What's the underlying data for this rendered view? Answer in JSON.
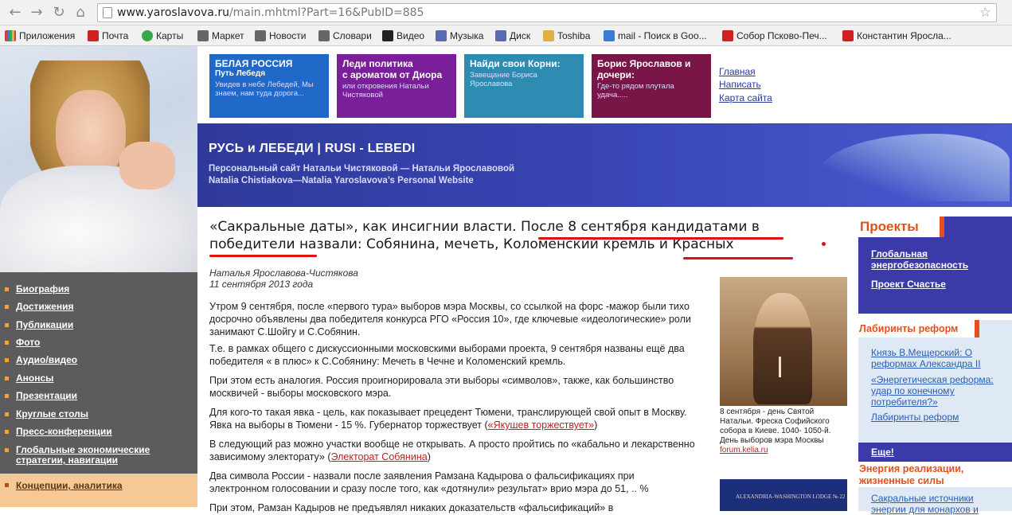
{
  "browser": {
    "url_host": "www.yaroslavova.ru",
    "url_path": "/main.mhtml?Part=16&PubID=885"
  },
  "bookmarks": [
    {
      "label": "Приложения",
      "color": "#3a7bd5"
    },
    {
      "label": "Почта",
      "color": "#d02020"
    },
    {
      "label": "Карты",
      "color": "#3aa84a"
    },
    {
      "label": "Маркет",
      "color": "#555555"
    },
    {
      "label": "Новости",
      "color": "#555555"
    },
    {
      "label": "Словари",
      "color": "#555555"
    },
    {
      "label": "Видео",
      "color": "#222222"
    },
    {
      "label": "Музыка",
      "color": "#5a6ab0"
    },
    {
      "label": "Диск",
      "color": "#5a6ab0"
    },
    {
      "label": "Toshiba",
      "color": "#e0b040"
    },
    {
      "label": "mail - Поиск в Goo...",
      "color": "#3a7bd5"
    },
    {
      "label": "Собор Псково-Печ...",
      "color": "#d02020"
    },
    {
      "label": "Константин Яросла...",
      "color": "#d02020"
    }
  ],
  "promos": [
    {
      "title": "БЕЛАЯ РОССИЯ",
      "sub": "Путь Лебедя",
      "desc": "Увидев в небе Лебедей, Мы знаем, нам туда дорога..."
    },
    {
      "title": "Леди политика",
      "sub": "с ароматом от Диора",
      "desc": "или откровения Натальи Чистяковой"
    },
    {
      "title": "Найди свои Корни:",
      "sub": "",
      "desc": "Завещание Бориса Ярославова"
    },
    {
      "title": "Борис Ярославов и дочери:",
      "sub": "",
      "desc": "Где-то рядом плутала удача....."
    }
  ],
  "top_links": [
    "Главная",
    "Написать",
    "Карта сайта"
  ],
  "site": {
    "title": "РУСЬ и ЛЕБЕДИ | RUSI - LEBEDI",
    "sub_ru": "Персональный сайт Натальи Чистяковой — Натальи Ярославовой",
    "sub_en": "Natalia Chistiakova—Natalia Yaroslavova’s  Personal Website"
  },
  "left_nav": [
    "Биография",
    "Достижения",
    "Публикации",
    "Фото",
    "Аудио/видео",
    "Анонсы",
    "Презентации",
    "Круглые столы",
    "Пресс-конференции",
    "Глобальные экономические стратегии, навигации"
  ],
  "left_nav_active": "Концепции, аналитика",
  "article": {
    "headline": "«Сакральные даты», как инсигнии власти. После 8 сентября кандидатами в победители назвали: Собянина, мечеть, Коломенский кремль и Красных",
    "author": "Наталья Ярославова-Чистякова",
    "date": "11 сентября 2013 года",
    "p1": "Утром 9 сентября, после «первого тура» выборов мэра Москвы, со ссылкой на форс -мажор были тихо досрочно объявлены два победителя конкурса РГО «Россия 10», где ключевые «идеологические» роли занимают С.Шойгу и С.Собянин.",
    "p2": "Т.е. в рамках общего с дискуссионными московскими выборами проекта, 9 сентября названы ещё два победителя « в плюс» к С.Собянину: Мечеть в Чечне и Коломенский кремль.",
    "p3": "При этом есть аналогия. Россия проигнорировала эти выборы «символов», также, как большинство москвичей - выборы московского мэра.",
    "p4": "Для кого-то такая явка - цель, как показывает прецедент Тюмени, транслирующей свой опыт в Москву. Явка на выборы в Тюмени - 15 %. Губернатор торжествует (",
    "p4_link": "«Якушев торжествует»",
    "p4_end": ")",
    "p5": "В следующий раз можно участки вообще не открывать. А просто пройтись по «кабально и лекарственно зависимому электорату» (",
    "p5_link": "Электорат Собянина",
    "p5_end": ")",
    "p6": "Два символа России - назвали после заявления Рамзана Кадырова о фальсификациях при электронном голосовании и сразу после того, как «дотянули» результат» врио мэра до 51, .. %",
    "p7": "При этом, Рамзан Кадыров не предъявлял никаких доказательств «фальсификаций» в"
  },
  "fresco": {
    "caption": "8 сентября - день Святой Натальи. Фреска Софийского собора в Киеве. 1040- 1050-й. День выборов мэра Москвы",
    "source": "forum.kelia.ru"
  },
  "lodge": "ALEXANDRIA-WASHINGTON LODGE № 22",
  "right": {
    "projects_title": "Проекты",
    "projects": [
      "Глобальная энергобезопасность",
      "Проект Счастье"
    ],
    "reforms_title": "Лабиринты реформ",
    "reforms": [
      "Князь В.Мещерский: О реформах Александра II",
      "«Энергетическая реформа: удар по конечному потребителя?»",
      "Лабиринты реформ"
    ],
    "more": "Еще!",
    "energy_title": "Энергия реализации, жизненные силы",
    "energy": [
      "Сакральные источники энергии для монархов и"
    ]
  },
  "colors": {
    "nav_bg": "#5c5c5c",
    "accent": "#e5501a",
    "banner": "#2f3a9a",
    "redline": "#e01010"
  }
}
